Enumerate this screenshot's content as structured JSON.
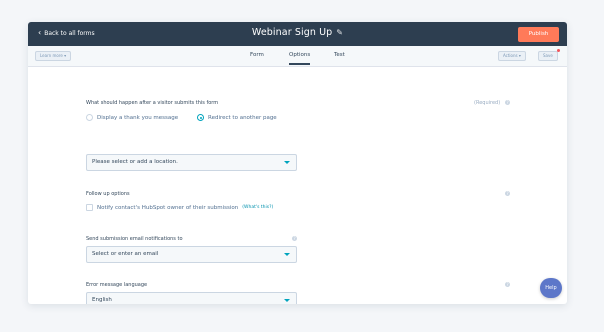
{
  "topbar": {
    "back_label": "Back to all forms",
    "title": "Webinar Sign Up",
    "publish_label": "Publish"
  },
  "subbar": {
    "left_button": "Learn more ▾",
    "tabs": [
      {
        "label": "Form"
      },
      {
        "label": "Options"
      },
      {
        "label": "Test"
      }
    ],
    "actions_label": "Actions ▾",
    "save_label": "Save"
  },
  "after_submit": {
    "label": "What should happen after a visitor submits this form",
    "required": "(Required)",
    "option_thank_you": "Display a thank you message",
    "option_redirect": "Redirect to another page",
    "selected": "redirect",
    "location_select": "Please select or add a location."
  },
  "follow_up": {
    "label": "Follow up options",
    "notify_label": "Notify contact's HubSpot owner of their submission",
    "whats_this": "(What's this?)"
  },
  "notifications": {
    "label": "Send submission email notifications to",
    "email_select": "Select or enter an email"
  },
  "language": {
    "label": "Error message language",
    "value": "English"
  },
  "help_fab": "Help",
  "colors": {
    "topbar": "#2d3e50",
    "publish": "#ff7a59",
    "accent": "#00a4bd",
    "help_fab": "#5d77c9"
  }
}
